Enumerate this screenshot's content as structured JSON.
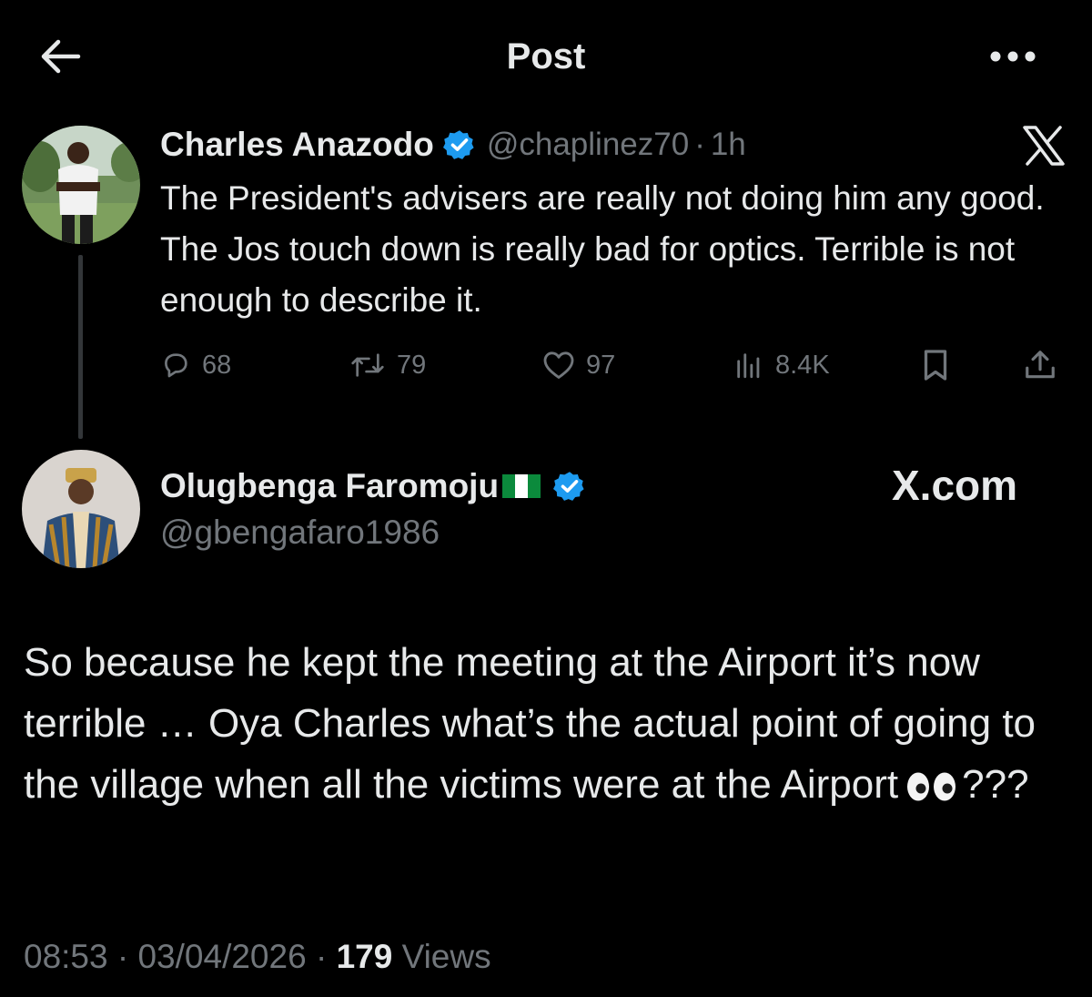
{
  "header": {
    "title": "Post"
  },
  "quoted_tweet": {
    "display_name": "Charles Anazodo",
    "handle": "@chaplinez70",
    "separator": "·",
    "time": "1h",
    "text": "The President's advisers are really not doing him any good. The Jos touch down is really bad for optics. Terrible is not enough to describe it.",
    "replies": "68",
    "retweets": "79",
    "likes": "97",
    "views": "8.4K"
  },
  "main_tweet": {
    "display_name": "Olugbenga Faromoju",
    "handle": "@gbengafaro1986",
    "watermark": "X.com",
    "text_before": "So because he kept the meeting at the Airport it’s now terrible … Oya Charles what’s the actual point of going to the village when all the victims were at the Airport",
    "text_after": "???",
    "time": "08:53",
    "date": "03/04/2026",
    "separator": "·",
    "views_count": "179",
    "views_label": "Views"
  },
  "colors": {
    "background": "#000000",
    "text_primary": "#e7e9ea",
    "text_secondary": "#71767b",
    "verified_badge": "#1d9bf0",
    "thread_line": "#333639"
  },
  "icons": {
    "back": "arrow-left-icon",
    "more": "more-dots-icon",
    "x_logo": "x-logo-icon",
    "verified": "verified-badge-icon",
    "reply": "reply-icon",
    "retweet": "retweet-icon",
    "like": "heart-icon",
    "views": "views-bar-chart-icon",
    "bookmark": "bookmark-icon",
    "share": "share-icon",
    "flag": "nigeria-flag-icon",
    "emoji": "eyes-emoji"
  }
}
